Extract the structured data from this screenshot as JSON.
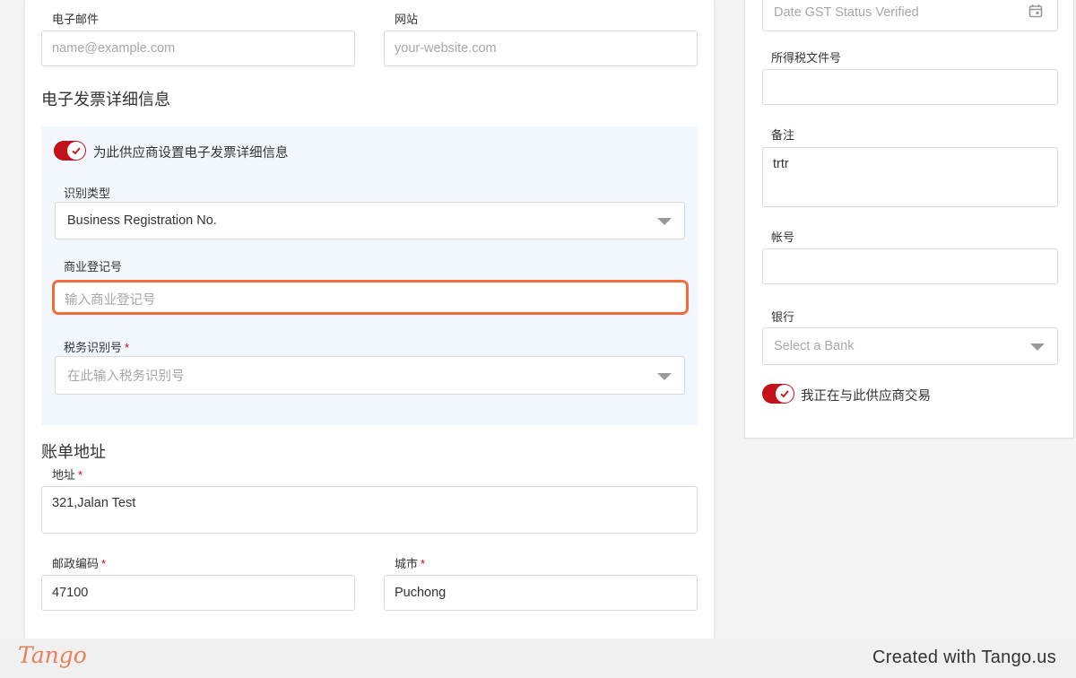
{
  "left": {
    "email_label": "电子邮件",
    "email_placeholder": "name@example.com",
    "website_label": "网站",
    "website_placeholder": "your-website.com",
    "einvoice_heading": "电子发票详细信息",
    "einvoice_toggle_label": "为此供应商设置电子发票详细信息",
    "id_type_label": "识别类型",
    "id_type_value": "Business Registration No.",
    "brn_label": "商业登记号",
    "brn_placeholder": "输入商业登记号",
    "tin_label": "税务识别号",
    "tin_placeholder": "在此输入税务识别号",
    "billing_heading": "账单地址",
    "address_label": "地址",
    "address_value": "321,Jalan Test",
    "postcode_label": "邮政编码",
    "postcode_value": "47100",
    "city_label": "城市",
    "city_value": "Puchong",
    "required_mark": "*"
  },
  "right": {
    "gst_date_placeholder": "Date GST Status Verified",
    "income_tax_label": "所得税文件号",
    "notes_label": "备注",
    "notes_value": "trtr",
    "account_label": "帐号",
    "bank_label": "银行",
    "bank_placeholder": "Select a Bank",
    "trading_toggle_label": "我正在与此供应商交易"
  },
  "footer": {
    "logo": "Tango",
    "credit": "Created with Tango.us"
  },
  "colors": {
    "toggle_on": "#c3111a",
    "highlight": "#f26b38",
    "panel_bg": "#f1f7fc"
  }
}
